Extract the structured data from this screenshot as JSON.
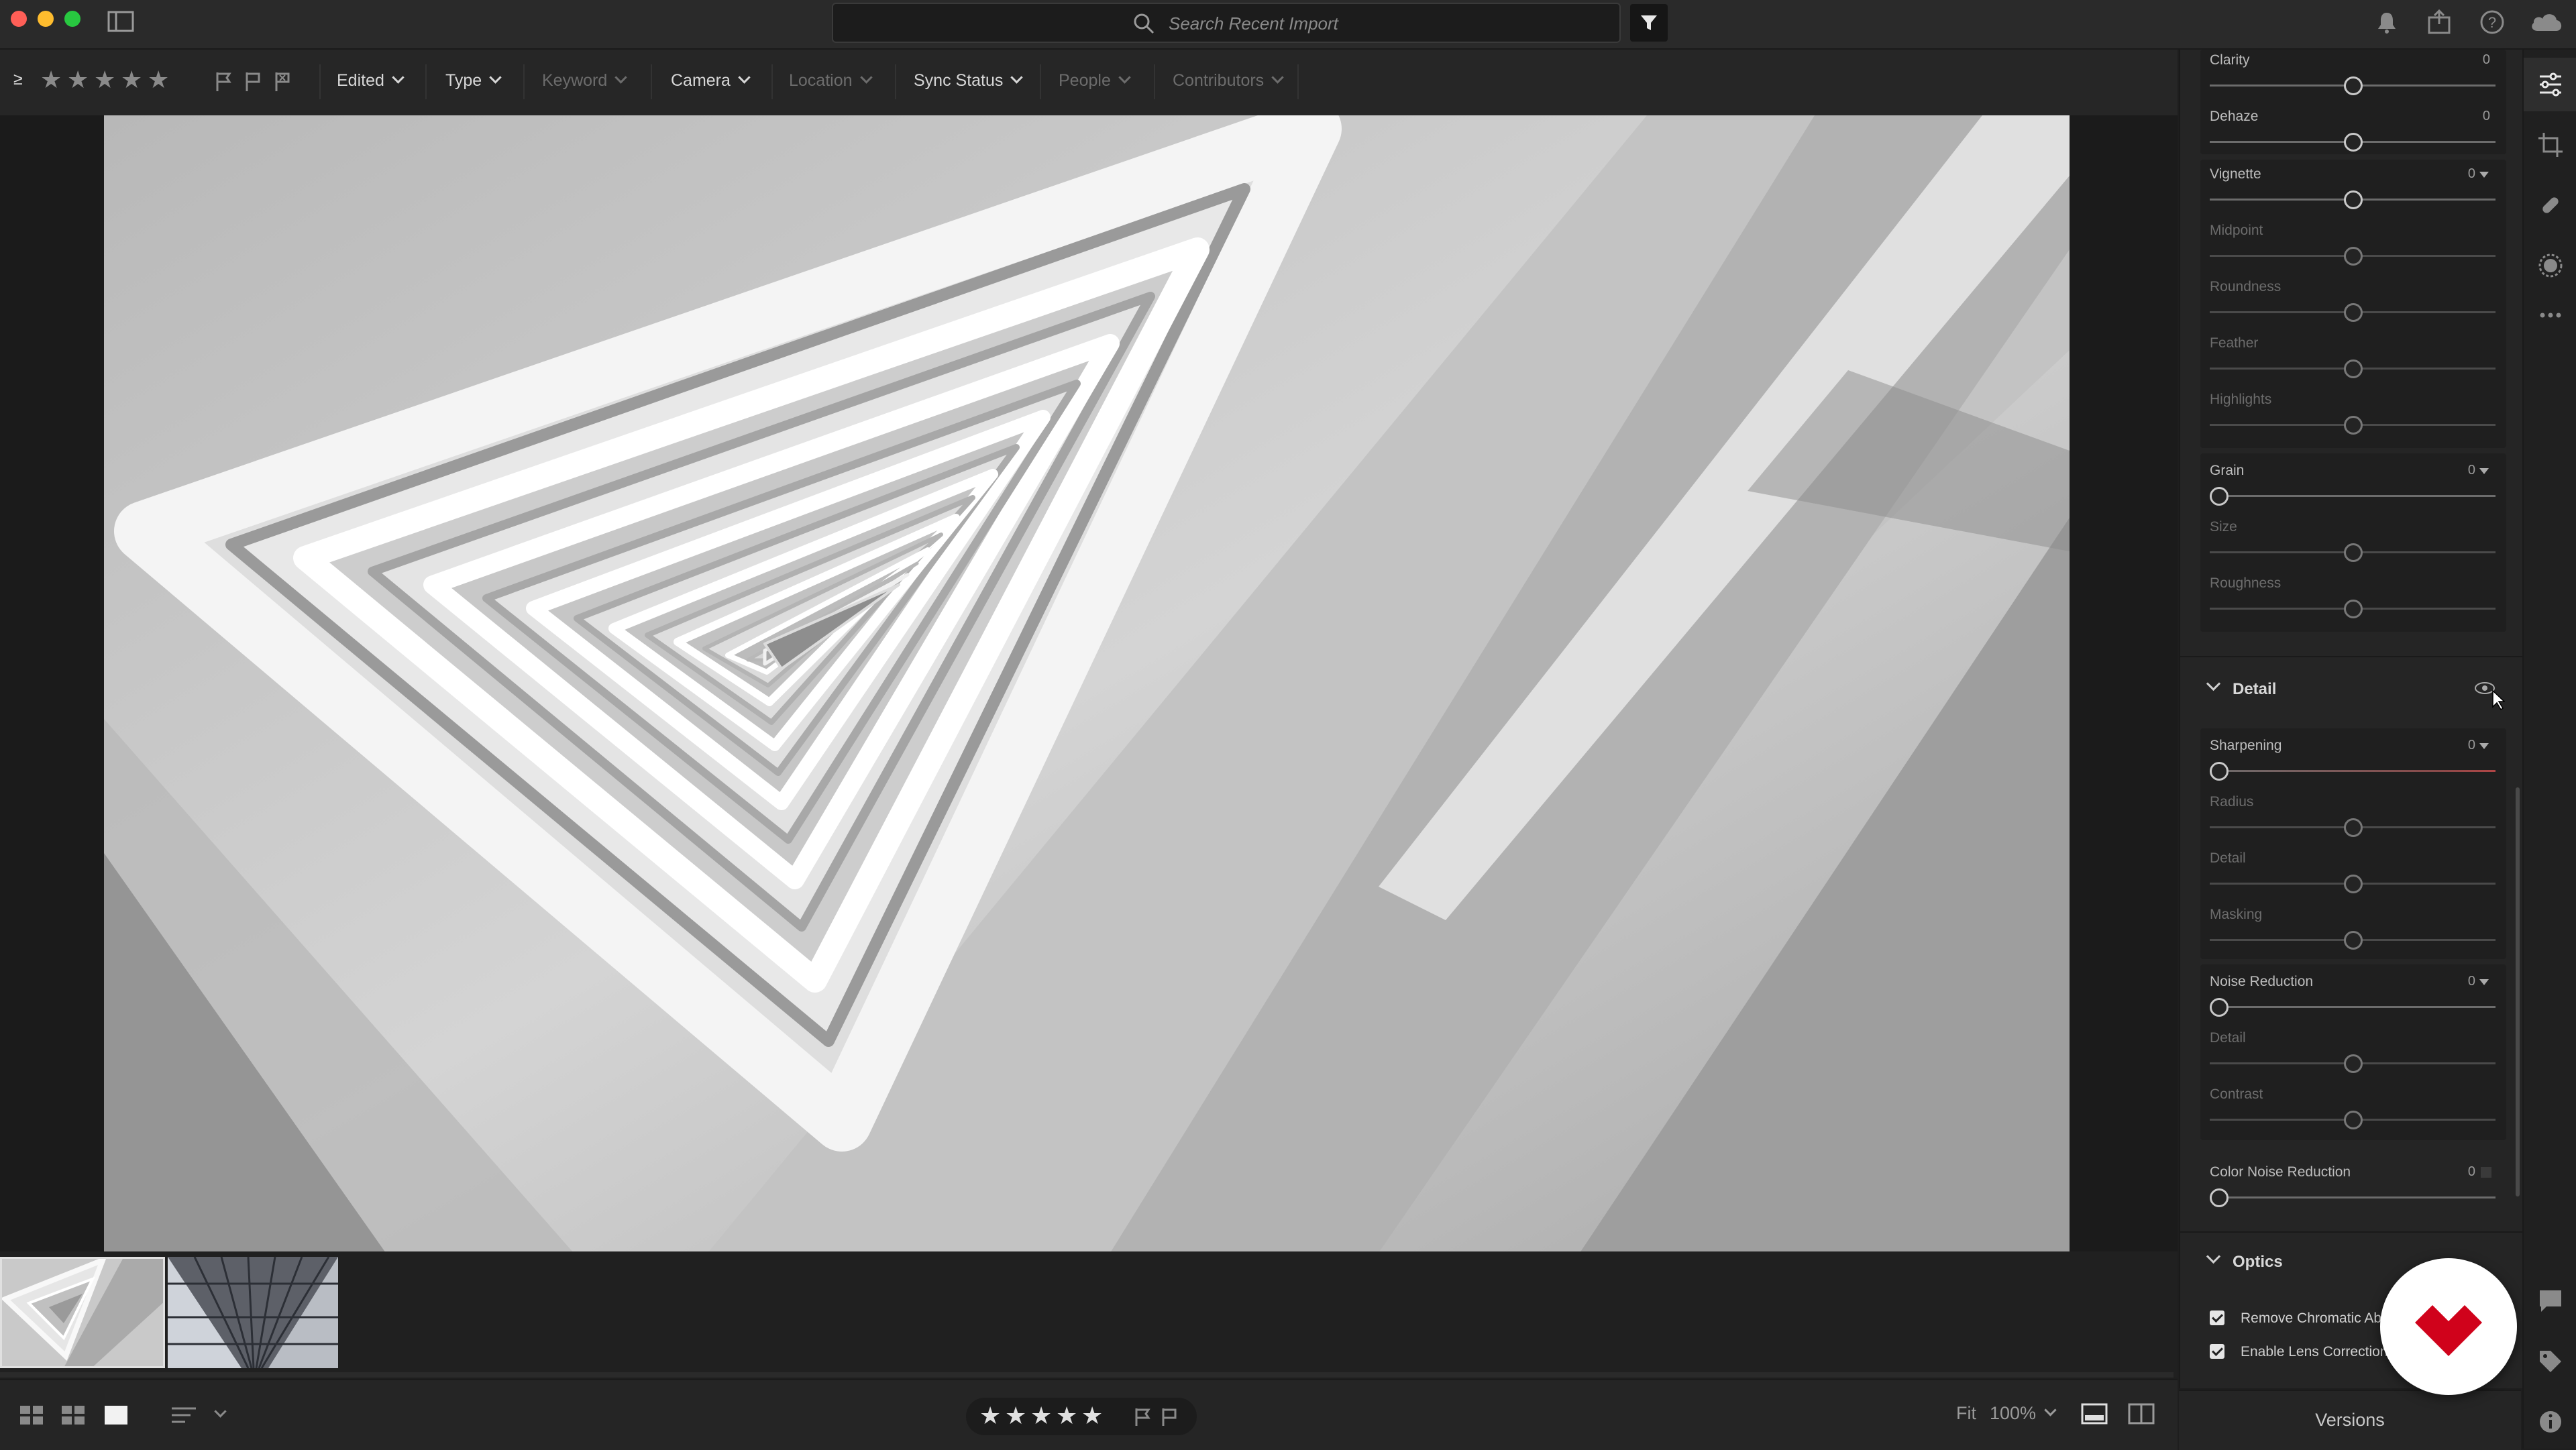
{
  "search": {
    "placeholder": "Search Recent Import"
  },
  "filterbar": {
    "rating_op": "≥",
    "stars": [
      "★",
      "★",
      "★",
      "★",
      "★"
    ],
    "filters": [
      {
        "label": "Edited",
        "active": true
      },
      {
        "label": "Type",
        "active": true
      },
      {
        "label": "Keyword",
        "active": false
      },
      {
        "label": "Camera",
        "active": true
      },
      {
        "label": "Location",
        "active": false
      },
      {
        "label": "Sync Status",
        "active": true
      },
      {
        "label": "People",
        "active": false
      },
      {
        "label": "Contributors",
        "active": false
      }
    ]
  },
  "panel": {
    "effects": {
      "clarity": {
        "label": "Clarity",
        "value": "0"
      },
      "dehaze": {
        "label": "Dehaze",
        "value": "0"
      }
    },
    "vignette": {
      "label": "Vignette",
      "value": "0",
      "midpoint": "Midpoint",
      "roundness": "Roundness",
      "feather": "Feather",
      "highlights": "Highlights"
    },
    "grain": {
      "label": "Grain",
      "value": "0",
      "size": "Size",
      "roughness": "Roughness"
    },
    "detail": {
      "title": "Detail",
      "sharpening": {
        "label": "Sharpening",
        "value": "0"
      },
      "radius": "Radius",
      "detail": "Detail",
      "masking": "Masking",
      "noise_reduction": {
        "label": "Noise Reduction",
        "value": "0"
      },
      "nr_detail": "Detail",
      "nr_contrast": "Contrast",
      "color_noise_reduction": {
        "label": "Color Noise Reduction",
        "value": "0"
      }
    },
    "optics": {
      "title": "Optics",
      "remove_ca": "Remove Chromatic Abe",
      "enable_lens": "Enable Lens Corrections"
    },
    "versions_label": "Versions"
  },
  "bottombar": {
    "fit_label": "Fit",
    "zoom": "100%",
    "stars": [
      "★",
      "★",
      "★",
      "★",
      "★"
    ]
  },
  "colors": {
    "close": "#ff5f57",
    "minimize": "#febc2e",
    "zoom": "#28c840",
    "badge": "#d0021b"
  }
}
